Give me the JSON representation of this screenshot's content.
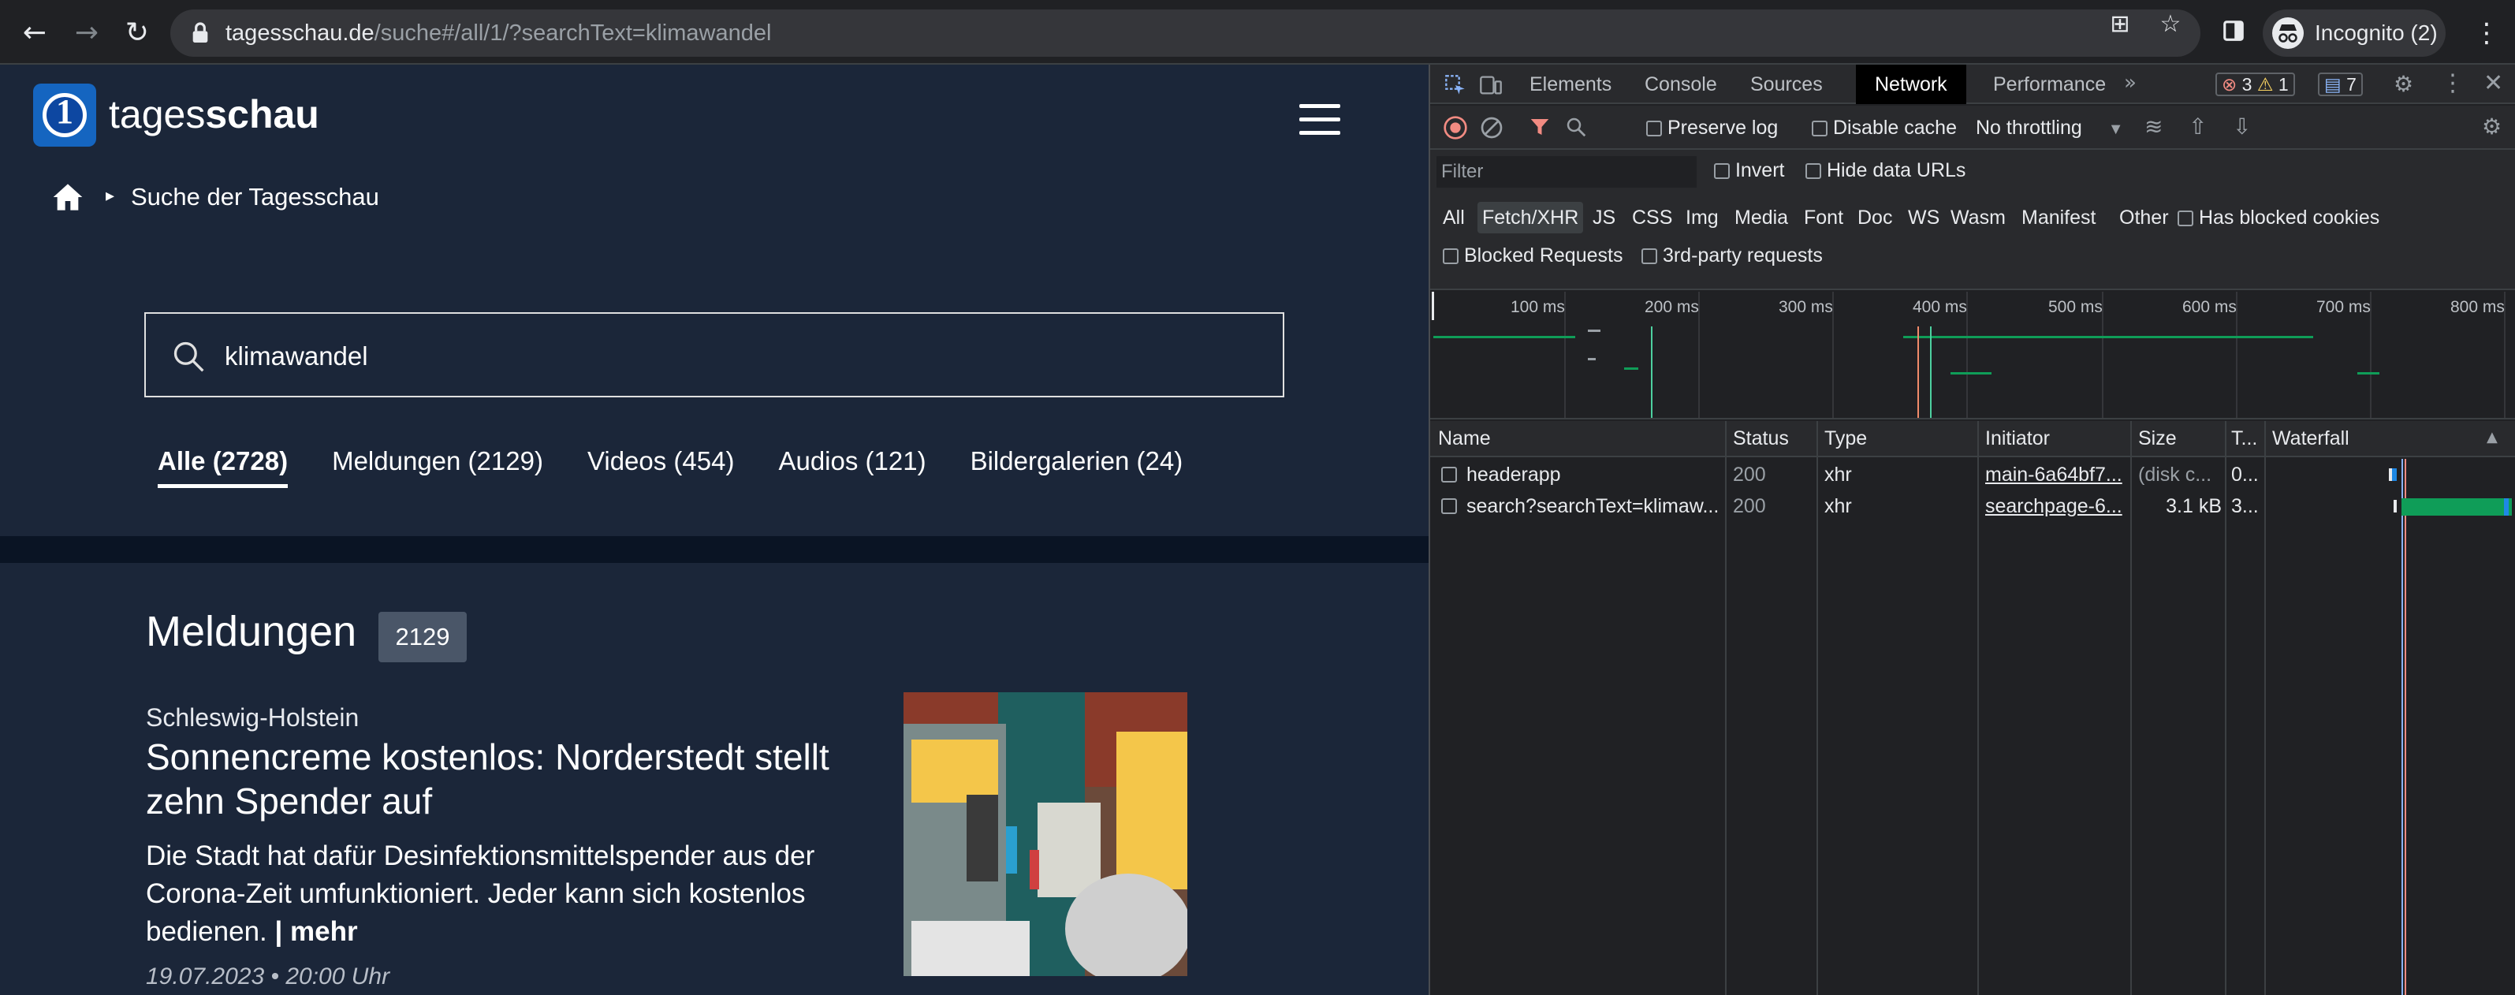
{
  "browser": {
    "url_host": "tagesschau.de",
    "url_path": "/suche#/all/1/?searchText=klimawandel",
    "profile_label": "Incognito (2)"
  },
  "site": {
    "logo_light": "tages",
    "logo_bold": "schau",
    "breadcrumb": "Suche der Tagesschau",
    "search_value": "klimawandel",
    "tabs": [
      {
        "label": "Alle (2728)"
      },
      {
        "label": "Meldungen (2129)"
      },
      {
        "label": "Videos (454)"
      },
      {
        "label": "Audios (121)"
      },
      {
        "label": "Bildergalerien (24)"
      }
    ],
    "section_title": "Meldungen",
    "section_count": "2129",
    "article": {
      "kicker": "Schleswig-Holstein",
      "headline": "Sonnencreme kostenlos: Norderstedt stellt zehn Spender auf",
      "teaser": "Die Stadt hat dafür Desinfektionsmittelspender aus der Corona-Zeit umfunktioniert. Jeder kann sich kostenlos bedienen. ",
      "more": "| mehr",
      "date": "19.07.2023 • 20:00 Uhr"
    }
  },
  "devtools": {
    "tabs": [
      "Elements",
      "Console",
      "Sources",
      "Network",
      "Performance"
    ],
    "errors": "3",
    "warnings": "1",
    "messages": "7",
    "preserve_log": "Preserve log",
    "disable_cache": "Disable cache",
    "throttling": "No throttling",
    "filter_placeholder": "Filter",
    "invert": "Invert",
    "hide_data_urls": "Hide data URLs",
    "types": [
      "All",
      "Fetch/XHR",
      "JS",
      "CSS",
      "Img",
      "Media",
      "Font",
      "Doc",
      "WS",
      "Wasm",
      "Manifest",
      "Other"
    ],
    "has_blocked_cookies": "Has blocked cookies",
    "blocked_requests": "Blocked Requests",
    "third_party": "3rd-party requests",
    "ticks": [
      "100 ms",
      "200 ms",
      "300 ms",
      "400 ms",
      "500 ms",
      "600 ms",
      "700 ms",
      "800 ms"
    ],
    "columns": [
      "Name",
      "Status",
      "Type",
      "Initiator",
      "Size",
      "T...",
      "Waterfall"
    ],
    "rows": [
      {
        "name": "headerapp",
        "status": "200",
        "type": "xhr",
        "initiator": "main-6a64bf7...",
        "size": "(disk c...",
        "time": "0..."
      },
      {
        "name": "search?searchText=klimaw...",
        "status": "200",
        "type": "xhr",
        "initiator": "searchpage-6...",
        "size": "3.1 kB",
        "time": "3..."
      }
    ],
    "colors": {
      "accent_green": "#0f9d58",
      "error_red": "#f28b82",
      "warn_orange": "#fdd663",
      "info_blue": "#8ab4f8"
    }
  }
}
